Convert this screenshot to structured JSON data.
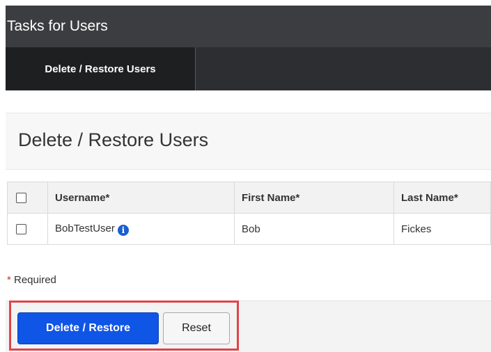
{
  "header": {
    "title": "Tasks for Users"
  },
  "tabs": [
    {
      "label": "Delete / Restore Users",
      "active": true
    }
  ],
  "section": {
    "title": "Delete / Restore Users"
  },
  "table": {
    "columns": [
      "Username*",
      "First Name*",
      "Last Name*"
    ],
    "rows": [
      {
        "username": "BobTestUser",
        "first_name": "Bob",
        "last_name": "Fickes",
        "selected": false
      }
    ]
  },
  "required_note": {
    "star": "*",
    "text": " Required"
  },
  "buttons": {
    "primary": "Delete / Restore",
    "secondary": "Reset"
  },
  "colors": {
    "primary_button": "#0f55e6",
    "header_bg": "#3c3d40",
    "highlight_border": "#e24248"
  },
  "icons": {
    "info": "info-icon"
  }
}
